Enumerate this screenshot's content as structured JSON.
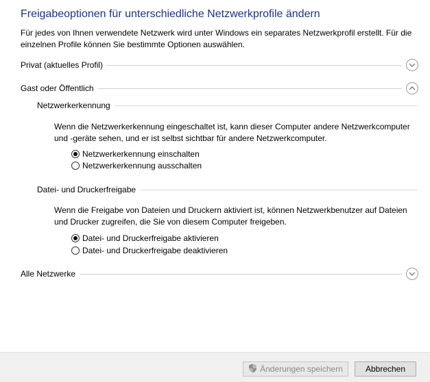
{
  "page": {
    "title": "Freigabeoptionen für unterschiedliche Netzwerkprofile ändern",
    "description_line1": "Für jedes von Ihnen verwendete Netzwerk wird unter Windows ein separates Netzwerkprofil erstellt. Für die",
    "description_line2": "einzelnen Profile können Sie bestimmte Optionen auswählen."
  },
  "profiles": {
    "private": {
      "label": "Privat (aktuelles Profil)",
      "expanded": false
    },
    "guest": {
      "label": "Gast oder Öffentlich",
      "expanded": true,
      "network_discovery": {
        "heading": "Netzwerkerkennung",
        "desc_line1": "Wenn die Netzwerkerkennung eingeschaltet ist, kann dieser Computer andere Netzwerkcomputer",
        "desc_line2": "und -geräte sehen, und er ist selbst sichtbar für andere Netzwerkcomputer.",
        "options": [
          {
            "label": "Netzwerkerkennung einschalten",
            "checked": true
          },
          {
            "label": "Netzwerkerkennung ausschalten",
            "checked": false
          }
        ]
      },
      "file_sharing": {
        "heading": "Datei- und Druckerfreigabe",
        "desc_line1": "Wenn die Freigabe von Dateien und Druckern aktiviert ist, können Netzwerkbenutzer auf Dateien",
        "desc_line2": "und Drucker zugreifen, die Sie von diesem Computer freigeben.",
        "options": [
          {
            "label": "Datei- und Druckerfreigabe aktivieren",
            "checked": true
          },
          {
            "label": "Datei- und Druckerfreigabe deaktivieren",
            "checked": false
          }
        ]
      }
    },
    "all": {
      "label": "Alle Netzwerke",
      "expanded": false
    }
  },
  "footer": {
    "save_label": "Änderungen speichern",
    "save_enabled": false,
    "cancel_label": "Abbrechen"
  },
  "colors": {
    "title": "#1e3287",
    "divider": "#cfcfcf",
    "footer_bg": "#f0f0f0"
  },
  "icons": {
    "collapsed": "chevron-down-icon",
    "expanded": "chevron-up-icon",
    "uac": "uac-shield-icon"
  }
}
